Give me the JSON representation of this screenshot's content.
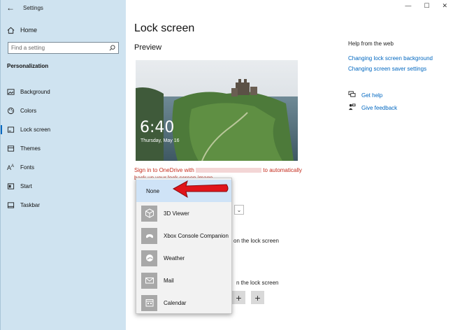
{
  "app": {
    "title": "Settings"
  },
  "sidebar": {
    "home_label": "Home",
    "search_placeholder": "Find a setting",
    "section_title": "Personalization",
    "items": [
      {
        "label": "Background",
        "icon": "picture-icon"
      },
      {
        "label": "Colors",
        "icon": "palette-icon"
      },
      {
        "label": "Lock screen",
        "icon": "lock-screen-icon",
        "active": true
      },
      {
        "label": "Themes",
        "icon": "brush-icon"
      },
      {
        "label": "Fonts",
        "icon": "fonts-icon"
      },
      {
        "label": "Start",
        "icon": "start-icon"
      },
      {
        "label": "Taskbar",
        "icon": "taskbar-icon"
      }
    ]
  },
  "window_controls": {
    "minimize": "—",
    "maximize": "☐",
    "close": "✕"
  },
  "main": {
    "title": "Lock screen",
    "preview_label": "Preview",
    "lock_time": "6:40",
    "lock_date": "Thursday, May 16",
    "warning_part1": "Sign in to OneDrive with",
    "warning_part2": "to automatically",
    "warning_part3": "back up your lock screen image",
    "bg_text_status": "on the lock screen",
    "bg_text_quick": "n the lock screen"
  },
  "help": {
    "title": "Help from the web",
    "links": [
      "Changing lock screen background",
      "Changing screen saver settings"
    ],
    "get_help": "Get help",
    "give_feedback": "Give feedback"
  },
  "popup": {
    "items": [
      {
        "label": "None",
        "icon": "none",
        "selected": true
      },
      {
        "label": "3D Viewer",
        "icon": "cube-icon"
      },
      {
        "label": "Xbox Console Companion",
        "icon": "xbox-icon"
      },
      {
        "label": "Weather",
        "icon": "weather-icon"
      },
      {
        "label": "Mail",
        "icon": "mail-icon"
      },
      {
        "label": "Calendar",
        "icon": "calendar-icon"
      }
    ]
  },
  "colors": {
    "sidebar_bg": "#cfe3f0",
    "accent": "#0067c0",
    "warning": "#c42b1c",
    "arrow": "#e0151b"
  }
}
